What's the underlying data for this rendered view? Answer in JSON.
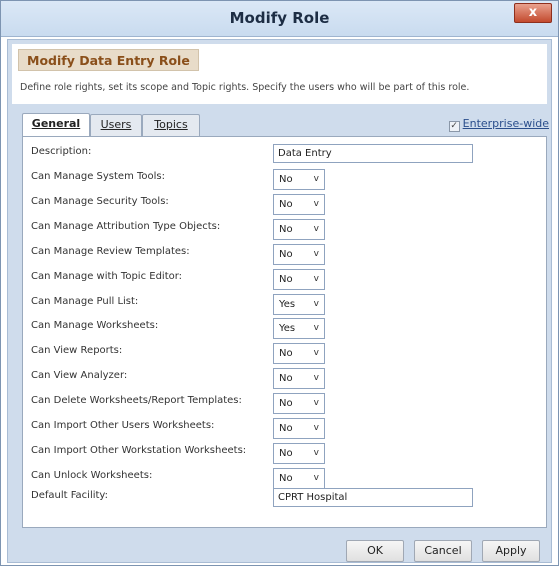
{
  "window": {
    "title": "Modify Role",
    "close_label": "x"
  },
  "header": {
    "title": "Modify Data Entry Role",
    "description": "Define role rights, set its scope and Topic rights. Specify the users who will be part of this role."
  },
  "tabs": [
    {
      "label": "General",
      "active": true
    },
    {
      "label": "Users",
      "active": false
    },
    {
      "label": "Topics",
      "active": false
    }
  ],
  "enterprise_wide": {
    "label": "Enterprise-wide",
    "checked": true,
    "check_mark": "✓"
  },
  "form": {
    "description": {
      "label": "Description:",
      "value": "Data Entry"
    },
    "rows": [
      {
        "label": "Can Manage System Tools:",
        "value": "No"
      },
      {
        "label": "Can Manage Security Tools:",
        "value": "No"
      },
      {
        "label": "Can Manage Attribution Type Objects:",
        "value": "No"
      },
      {
        "label": "Can Manage Review Templates:",
        "value": "No"
      },
      {
        "label": "Can Manage with Topic Editor:",
        "value": "No"
      },
      {
        "label": "Can Manage Pull List:",
        "value": "Yes"
      },
      {
        "label": "Can Manage Worksheets:",
        "value": "Yes"
      },
      {
        "label": "Can View Reports:",
        "value": "No"
      },
      {
        "label": "Can View Analyzer:",
        "value": "No"
      },
      {
        "label": "Can Delete Worksheets/Report Templates:",
        "value": "No"
      },
      {
        "label": "Can Import Other Users Worksheets:",
        "value": "No"
      },
      {
        "label": "Can Import Other Workstation Worksheets:",
        "value": "No"
      },
      {
        "label": "Can Unlock Worksheets:",
        "value": "No"
      }
    ],
    "default_facility": {
      "label": "Default Facility:",
      "value": "CPRT Hospital"
    },
    "dropdown_glyph": "v"
  },
  "buttons": {
    "ok": "OK",
    "cancel": "Cancel",
    "apply": "Apply"
  }
}
